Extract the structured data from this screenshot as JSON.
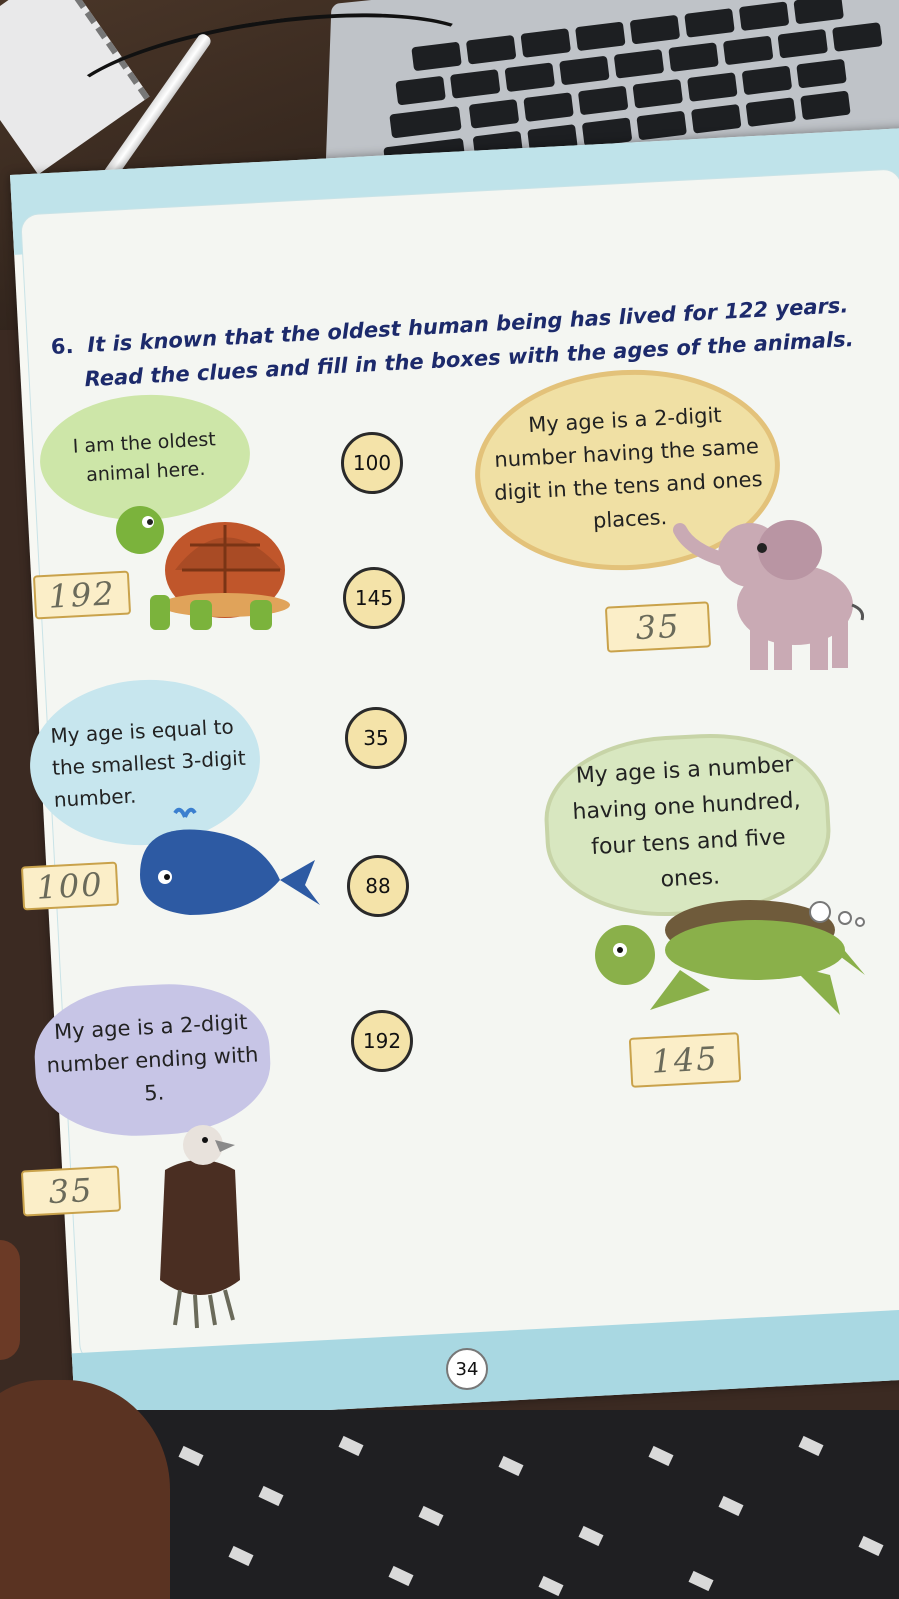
{
  "question": {
    "number": "6.",
    "line1": "It is known that the oldest human being has lived for 122 years.",
    "line2": "Read the clues and fill in the boxes with the ages of the animals."
  },
  "clues": {
    "tortoise": "I am the oldest animal here.",
    "elephant": "My age is a 2-digit number having the same digit in the tens and ones places.",
    "whale": "My age is equal to the smallest 3-digit number.",
    "sea_turtle": "My age is a number having one hundred, four tens and five ones.",
    "vulture": "My age is a 2-digit number ending with 5."
  },
  "options": [
    "100",
    "145",
    "35",
    "88",
    "192"
  ],
  "answers": {
    "tortoise": "192",
    "elephant": "35",
    "whale": "100",
    "sea_turtle": "145",
    "vulture": "35"
  },
  "page_number": "34",
  "colors": {
    "title": "#1c2a6b",
    "option_fill": "#f4e3a9",
    "answer_fill": "#fbeec8",
    "band": "#bfe3ea"
  }
}
